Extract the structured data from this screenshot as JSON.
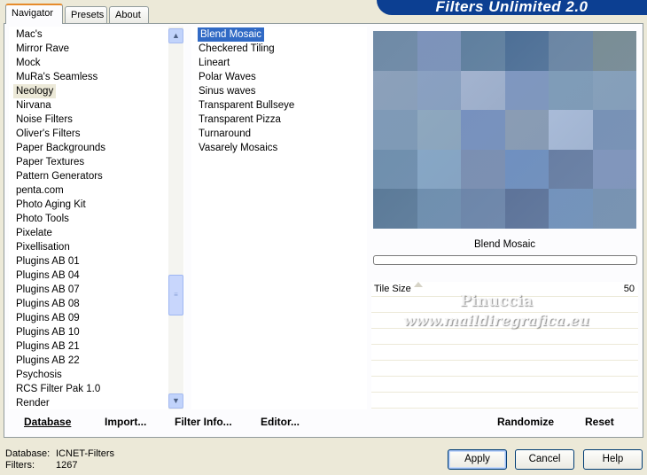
{
  "window": {
    "title_banner": "Filters Unlimited 2.0"
  },
  "tabs": [
    {
      "label": "Navigator",
      "active": true
    },
    {
      "label": "Presets",
      "active": false
    },
    {
      "label": "About",
      "active": false
    }
  ],
  "categories": {
    "items": [
      "Mac's",
      "Mirror Rave",
      "Mock",
      "MuRa's Seamless",
      "Neology",
      "Nirvana",
      "Noise Filters",
      "Oliver's Filters",
      "Paper Backgrounds",
      "Paper Textures",
      "Pattern Generators",
      "penta.com",
      "Photo Aging Kit",
      "Photo Tools",
      "Pixelate",
      "Pixellisation",
      "Plugins AB 01",
      "Plugins AB 04",
      "Plugins AB 07",
      "Plugins AB 08",
      "Plugins AB 09",
      "Plugins AB 10",
      "Plugins AB 21",
      "Plugins AB 22",
      "Psychosis",
      "RCS Filter Pak 1.0",
      "Render"
    ],
    "selected": "Neology"
  },
  "filters": {
    "items": [
      "Blend Mosaic",
      "Checkered Tiling",
      "Lineart",
      "Polar Waves",
      "Sinus waves",
      "Transparent Bullseye",
      "Transparent Pizza",
      "Turnaround",
      "Vasarely Mosaics"
    ],
    "selected": "Blend Mosaic"
  },
  "preview": {
    "tile_colors": [
      "#6f8aa6",
      "#7d93bb",
      "#5f7f9e",
      "#4d6f96",
      "#6b86a4",
      "#7a8d94",
      "#8ca1bb",
      "#8aa1c2",
      "#a3b3cf",
      "#7f97c0",
      "#7f9cb8",
      "#86a0bb",
      "#7f9ab7",
      "#8ea8bf",
      "#7791bf",
      "#8a9cb4",
      "#a9bbd8",
      "#7892b6",
      "#6f8fae",
      "#87a7c6",
      "#7b8fb2",
      "#6f90c0",
      "#687ea3",
      "#8196bd",
      "#5b7a98",
      "#6f8faf",
      "#6d86aa",
      "#5d7399",
      "#7393bc",
      "#7893b2"
    ],
    "filter_name": "Blend Mosaic",
    "progress": 0
  },
  "parameters": [
    {
      "label": "Tile Size",
      "value": "50"
    }
  ],
  "watermark": {
    "line1": "Pinuccia",
    "line2": "www.maildiregrafica.eu"
  },
  "buttons": {
    "database": "Database",
    "import": "Import...",
    "filter_info": "Filter Info...",
    "editor": "Editor...",
    "randomize": "Randomize",
    "reset": "Reset",
    "apply": "Apply",
    "cancel": "Cancel",
    "help": "Help"
  },
  "status": {
    "database_label": "Database:",
    "database_value": "ICNET-Filters",
    "filters_label": "Filters:",
    "filters_value": "1267"
  },
  "colors": {
    "selection_highlight": "#316ac5",
    "title_banner_bg": "#0c3f92",
    "dialog_bg": "#ece9d8"
  }
}
